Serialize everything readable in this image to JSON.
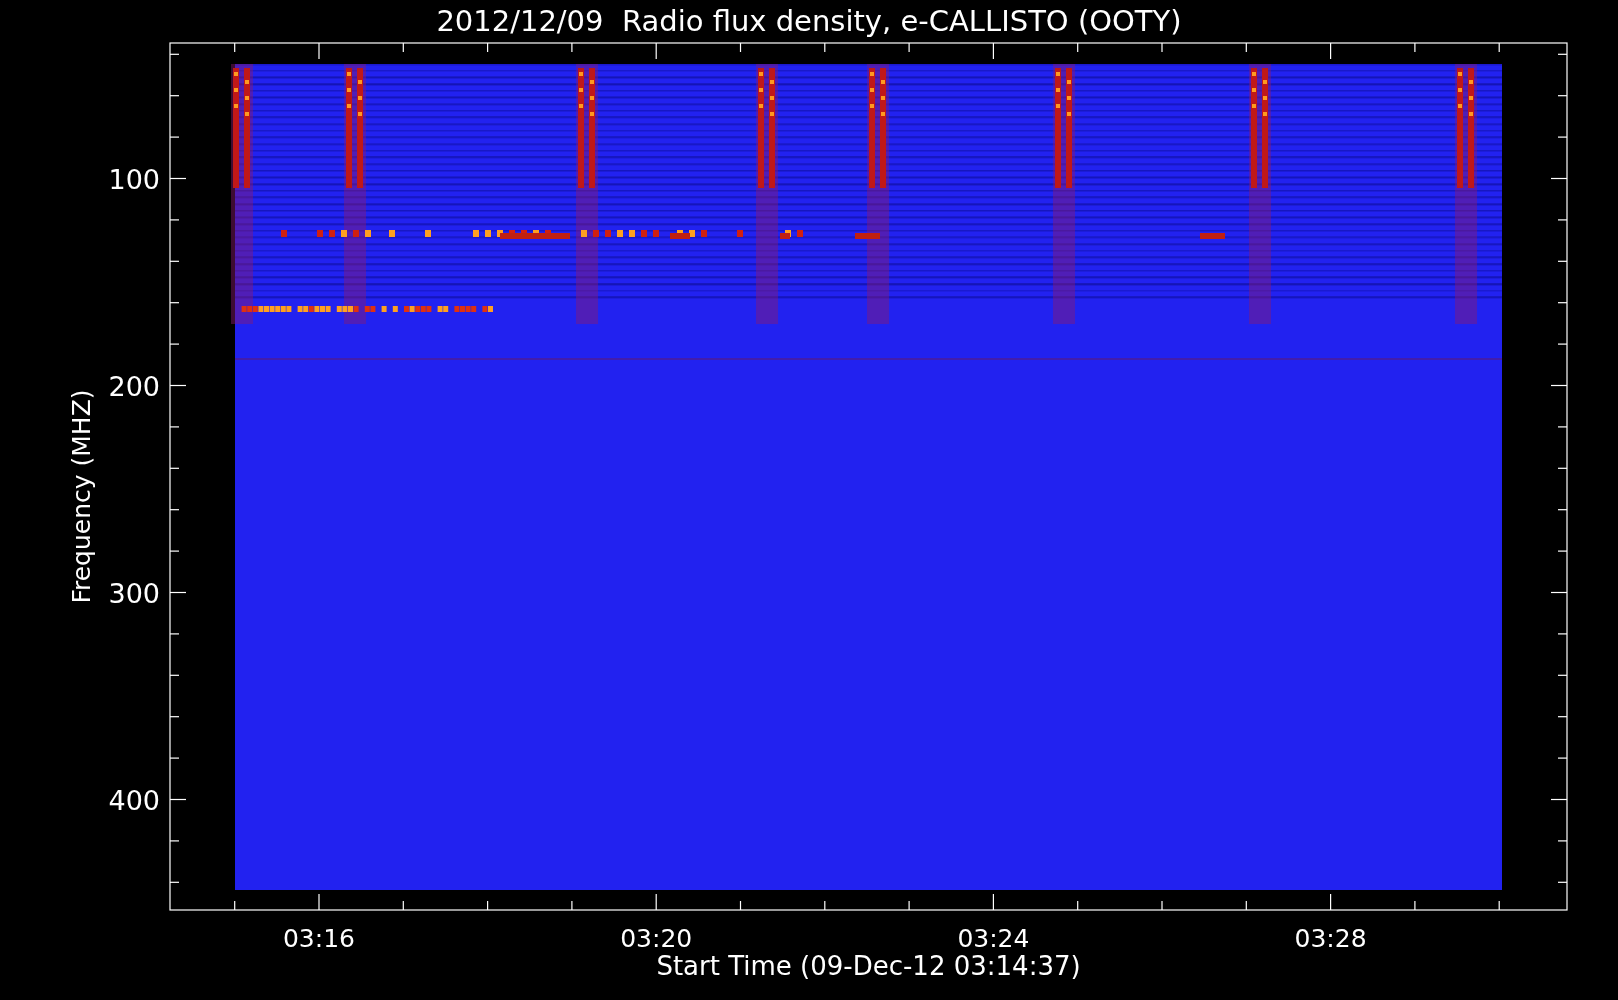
{
  "plot": {
    "title": "2012/12/09  Radio flux density, e-CALLISTO (OOTY)",
    "xlabel": "Start Time (09-Dec-12 03:14:37)",
    "ylabel": "Frequency (MHZ)",
    "xticks": [
      {
        "label": "03:16"
      },
      {
        "label": "03:20"
      },
      {
        "label": "03:24"
      },
      {
        "label": "03:28"
      }
    ],
    "yticks": [
      {
        "label": "100"
      },
      {
        "label": "200"
      },
      {
        "label": "300"
      },
      {
        "label": "400"
      }
    ]
  }
}
